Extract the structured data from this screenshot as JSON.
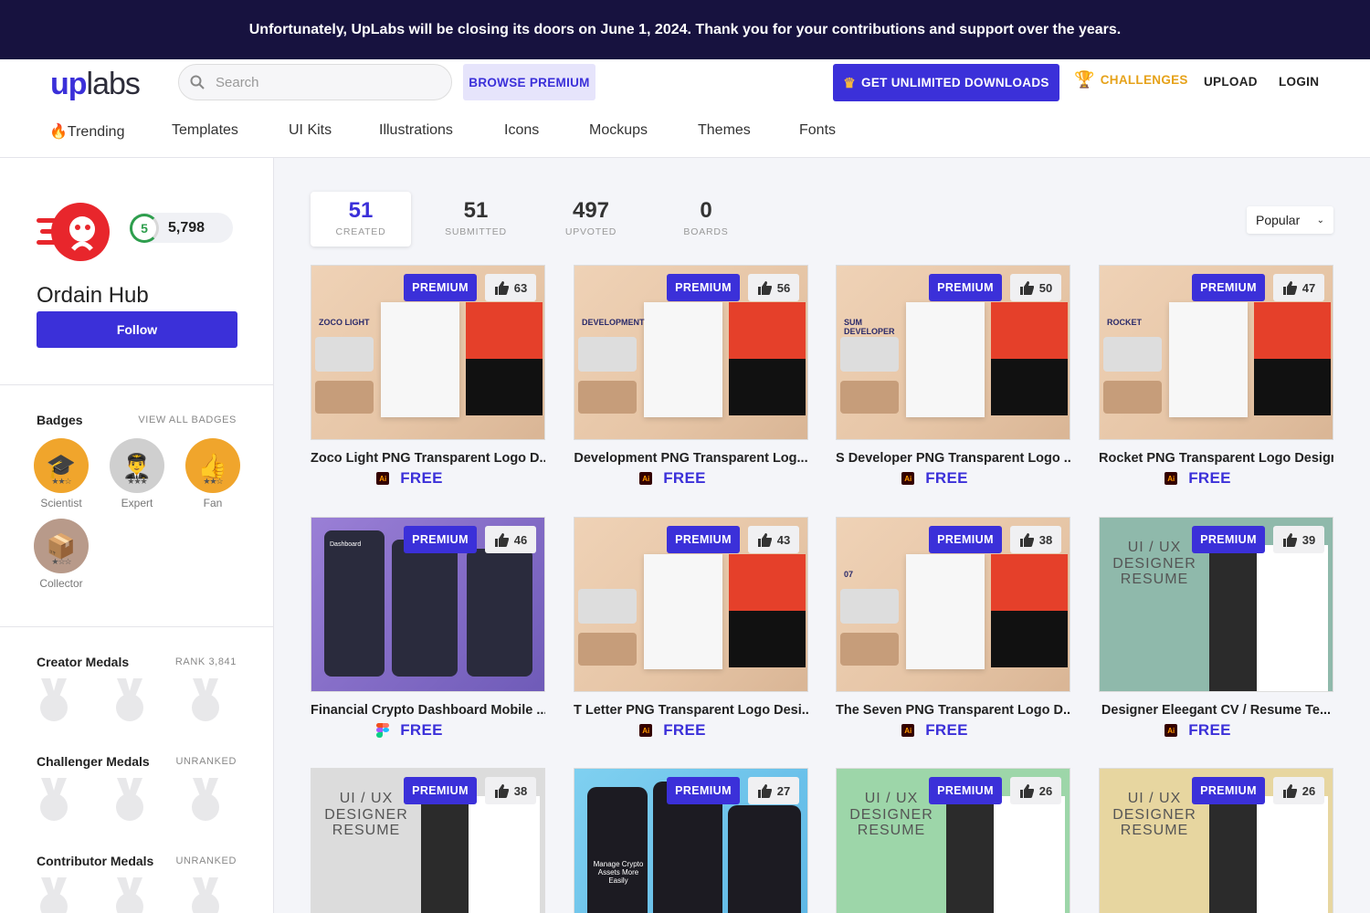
{
  "banner": {
    "text": "Unfortunately, UpLabs will be closing its doors on June 1, 2024. Thank you for your contributions and support over the years."
  },
  "header": {
    "logo_up": "up",
    "logo_labs": "labs",
    "search_placeholder": "Search",
    "browse_premium": "BROWSE PREMIUM",
    "get_unlimited": "GET UNLIMITED DOWNLOADS",
    "challenges": "CHALLENGES",
    "upload": "UPLOAD",
    "login": "LOGIN"
  },
  "nav": {
    "items": [
      {
        "label": "🔥Trending"
      },
      {
        "label": "Templates"
      },
      {
        "label": "UI Kits"
      },
      {
        "label": "Illustrations"
      },
      {
        "label": "Icons"
      },
      {
        "label": "Mockups"
      },
      {
        "label": "Themes"
      },
      {
        "label": "Fonts"
      }
    ]
  },
  "profile": {
    "level": "5",
    "points": "5,798",
    "name": "Ordain Hub",
    "follow": "Follow"
  },
  "badges": {
    "title": "Badges",
    "view_all": "VIEW ALL BADGES",
    "items": [
      {
        "label": "Scientist",
        "icon": "graduation-cap"
      },
      {
        "label": "Expert",
        "icon": "pilot"
      },
      {
        "label": "Fan",
        "icon": "thumbs-up"
      },
      {
        "label": "Collector",
        "icon": "box"
      }
    ]
  },
  "medals": [
    {
      "title": "Creator Medals",
      "meta": "RANK 3,841"
    },
    {
      "title": "Challenger Medals",
      "meta": "UNRANKED"
    },
    {
      "title": "Contributor Medals",
      "meta": "UNRANKED"
    }
  ],
  "stats": [
    {
      "num": "51",
      "label": "CREATED"
    },
    {
      "num": "51",
      "label": "SUBMITTED"
    },
    {
      "num": "497",
      "label": "UPVOTED"
    },
    {
      "num": "0",
      "label": "BOARDS"
    }
  ],
  "sort": {
    "value": "Popular"
  },
  "cards": [
    {
      "title": "Zoco Light PNG Transparent Logo D...",
      "votes": "63",
      "price": "FREE",
      "badge": "PREMIUM",
      "tool": "ai",
      "brand": "ZOCO LIGHT",
      "theme": "cream"
    },
    {
      "title": "Development PNG Transparent Log...",
      "votes": "56",
      "price": "FREE",
      "badge": "PREMIUM",
      "tool": "ai",
      "brand": "DEVELOPMENT",
      "theme": "cream"
    },
    {
      "title": "S Developer PNG Transparent Logo ...",
      "votes": "50",
      "price": "FREE",
      "badge": "PREMIUM",
      "tool": "ai",
      "brand": "SUM DEVELOPER",
      "theme": "cream"
    },
    {
      "title": "Rocket PNG Transparent Logo Design",
      "votes": "47",
      "price": "FREE",
      "badge": "PREMIUM",
      "tool": "ai",
      "brand": "ROCKET",
      "theme": "cream"
    },
    {
      "title": "Financial Crypto Dashboard Mobile ...",
      "votes": "46",
      "price": "FREE",
      "badge": "PREMIUM",
      "tool": "figma",
      "brand": "Dashboard",
      "theme": "purple"
    },
    {
      "title": "T Letter PNG Transparent Logo Desi...",
      "votes": "43",
      "price": "FREE",
      "badge": "PREMIUM",
      "tool": "ai",
      "brand": "",
      "theme": "cream"
    },
    {
      "title": "The Seven PNG Transparent Logo D...",
      "votes": "38",
      "price": "FREE",
      "badge": "PREMIUM",
      "tool": "ai",
      "brand": "07",
      "theme": "cream"
    },
    {
      "title": "Designer Eleegant CV / Resume Te...",
      "votes": "39",
      "price": "FREE",
      "badge": "PREMIUM",
      "tool": "ai",
      "brand": "UI / UX DESIGNER RESUME",
      "theme": "teal"
    },
    {
      "title": "",
      "votes": "38",
      "price": "",
      "badge": "PREMIUM",
      "tool": "",
      "brand": "UI / UX DESIGNER RESUME",
      "theme": "grey"
    },
    {
      "title": "",
      "votes": "27",
      "price": "",
      "badge": "PREMIUM",
      "tool": "",
      "brand": "Manage Crypto Assets More Easily",
      "theme": "sky"
    },
    {
      "title": "",
      "votes": "26",
      "price": "",
      "badge": "PREMIUM",
      "tool": "",
      "brand": "UI / UX DESIGNER RESUME",
      "theme": "green"
    },
    {
      "title": "",
      "votes": "26",
      "price": "",
      "badge": "PREMIUM",
      "tool": "",
      "brand": "UI / UX DESIGNER RESUME",
      "theme": "sand"
    }
  ],
  "colors": {
    "accent": "#3b30d9",
    "banner": "#17123f",
    "gold": "#e6a21a",
    "free": "#3b30d9"
  }
}
